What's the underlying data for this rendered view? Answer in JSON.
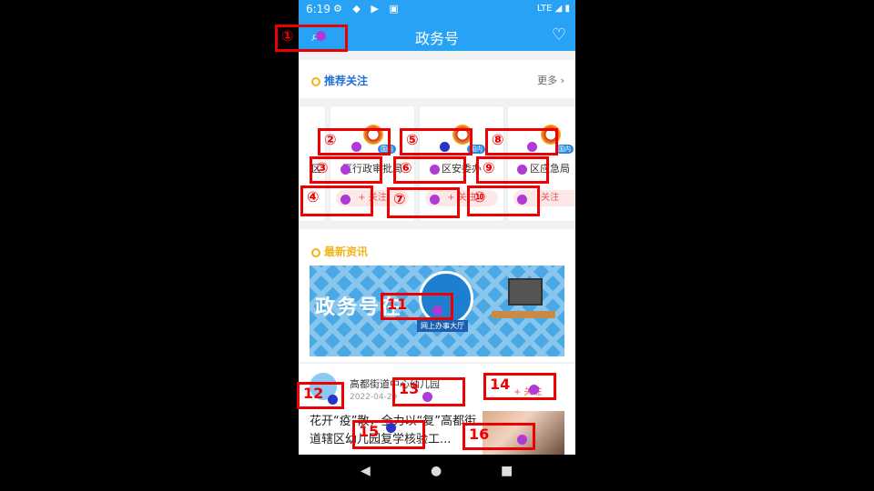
{
  "status": {
    "time": "6:19",
    "icons": "⚙ ◆ ▶ ▣",
    "right": "LTE ◢ ▮"
  },
  "appbar": {
    "title": "政务号",
    "back_icon": "search-icon",
    "fav_icon": "heart-plus-icon"
  },
  "recommend": {
    "heading": "推荐关注",
    "more": "更多",
    "cards": [
      {
        "name": "区",
        "follow": ""
      },
      {
        "name": "区行政审批局",
        "follow": "+ 关注"
      },
      {
        "name": "区安委办",
        "follow": "+ 关注"
      },
      {
        "name": "区应急局",
        "follow": "关注"
      }
    ],
    "badge": "国内"
  },
  "latest": {
    "heading": "最新资讯"
  },
  "banner": {
    "big_text": "政务号在",
    "sub_text": "网上办事大厅"
  },
  "news": {
    "source": "高都街道中心幼儿园",
    "date": "2022-04-29",
    "follow": "+ 关注",
    "headline": "花开“疫”散，全力以“复”高都街道辖区幼儿园复学核验工..."
  },
  "navbar": {
    "back": "◀",
    "home": "●",
    "recents": "■"
  },
  "marks": [
    "①",
    "②",
    "③",
    "④",
    "⑤",
    "⑥",
    "⑦",
    "⑧",
    "⑨",
    "⑩",
    "11",
    "12",
    "13",
    "14",
    "15",
    "16"
  ]
}
